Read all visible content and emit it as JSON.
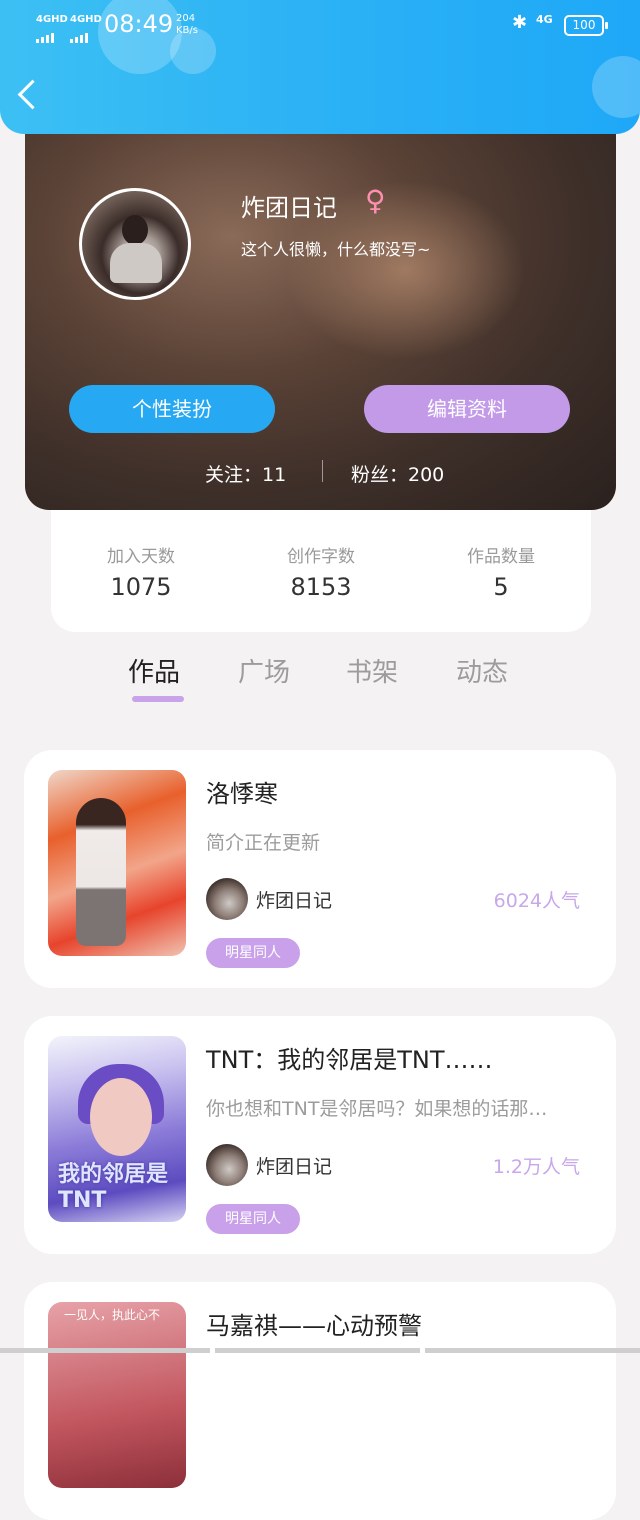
{
  "status_bar": {
    "signal1": "4GHD",
    "signal2": "4GHD",
    "time": "08:49",
    "speed_value": "204",
    "speed_unit": "KB/s",
    "network": "4G",
    "battery": "100"
  },
  "profile": {
    "name": "炸团日记",
    "gender_symbol": "♀",
    "bio": "这个人很懒，什么都没写~",
    "buttons": {
      "decorate": "个性装扮",
      "edit": "编辑资料"
    },
    "following": "关注：11",
    "fans": "粉丝：200"
  },
  "stats": [
    {
      "label": "加入天数",
      "value": "1075"
    },
    {
      "label": "创作字数",
      "value": "8153"
    },
    {
      "label": "作品数量",
      "value": "5"
    }
  ],
  "tabs": [
    {
      "label": "作品",
      "active": true
    },
    {
      "label": "广场",
      "active": false
    },
    {
      "label": "书架",
      "active": false
    },
    {
      "label": "动态",
      "active": false
    }
  ],
  "works": [
    {
      "title": "洛悸寒",
      "desc": "简介正在更新",
      "author": "炸团日记",
      "popularity": "6024人气",
      "tag": "明星同人"
    },
    {
      "title": "TNT：我的邻居是TNT……",
      "desc": "你也想和TNT是邻居吗？如果想的话那…",
      "author": "炸团日记",
      "popularity": "1.2万人气",
      "tag": "明星同人",
      "cover_text": "我的邻居是TNT"
    },
    {
      "title": "马嘉祺——心动预警",
      "cover_text": "一见人，执此心不"
    }
  ],
  "colors": {
    "header_blue": "#2ab0f5",
    "accent_purple": "#c29ae8",
    "button_blue": "#27a8f3",
    "popularity_purple": "#c8a7ea"
  }
}
